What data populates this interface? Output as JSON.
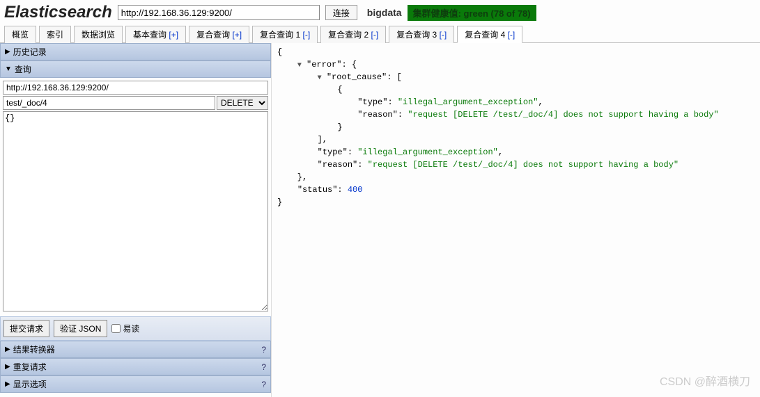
{
  "header": {
    "logo": "Elasticsearch",
    "url": "http://192.168.36.129:9200/",
    "connect_label": "连接",
    "cluster_name": "bigdata",
    "health_label": "集群健康值: green (78 of 78)"
  },
  "tabs": [
    {
      "label": "概览",
      "suffix": ""
    },
    {
      "label": "索引",
      "suffix": ""
    },
    {
      "label": "数据浏览",
      "suffix": ""
    },
    {
      "label": "基本查询",
      "suffix": "[+]"
    },
    {
      "label": "复合查询",
      "suffix": "[+]"
    },
    {
      "label": "复合查询 1",
      "suffix": "[-]"
    },
    {
      "label": "复合查询 2",
      "suffix": "[-]"
    },
    {
      "label": "复合查询 3",
      "suffix": "[-]"
    },
    {
      "label": "复合查询 4",
      "suffix": "[-]"
    }
  ],
  "active_tab": 8,
  "sections": {
    "history": "历史记录",
    "query": "查询",
    "result_transformer": "结果转换器",
    "repeat_request": "重复请求",
    "display_options": "显示选项",
    "help": "?"
  },
  "query": {
    "url_value": "http://192.168.36.129:9200/",
    "path_value": "test/_doc/4",
    "method": "DELETE",
    "body_value": "{}"
  },
  "actions": {
    "submit": "提交请求",
    "validate": "验证 JSON",
    "readable": "易读"
  },
  "response": {
    "error": {
      "root_cause": [
        {
          "type": "illegal_argument_exception",
          "reason": "request [DELETE /test/_doc/4] does not support having a body"
        }
      ],
      "type": "illegal_argument_exception",
      "reason": "request [DELETE /test/_doc/4] does not support having a body"
    },
    "status": 400
  },
  "watermark": "CSDN @醉酒横刀"
}
